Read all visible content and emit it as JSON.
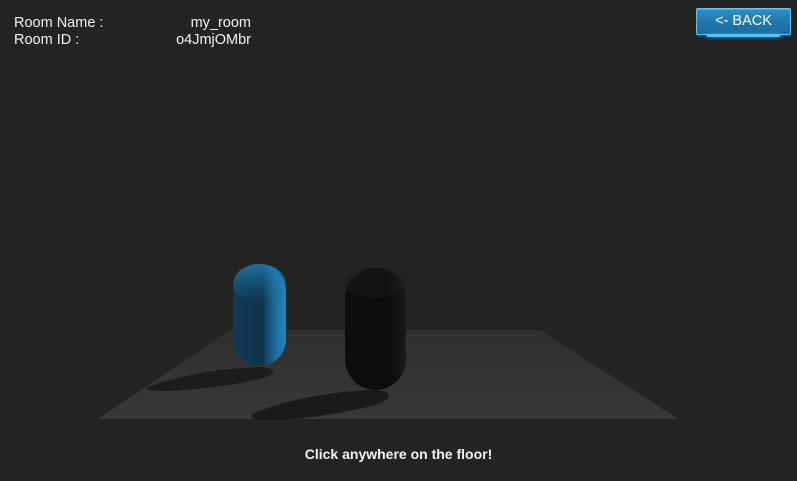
{
  "room": {
    "name_label": "Room Name :",
    "name_value": "my_room",
    "id_label": "Room ID :",
    "id_value": "o4JmjOMbr"
  },
  "toolbar": {
    "back_label": "<- BACK"
  },
  "hint": "Click anywhere on the floor!",
  "colors": {
    "background": "#232323",
    "floor": "#343434",
    "player_blue": "#1a6d9c",
    "player_black": "#111111",
    "button_accent": "#2a8cc0"
  }
}
